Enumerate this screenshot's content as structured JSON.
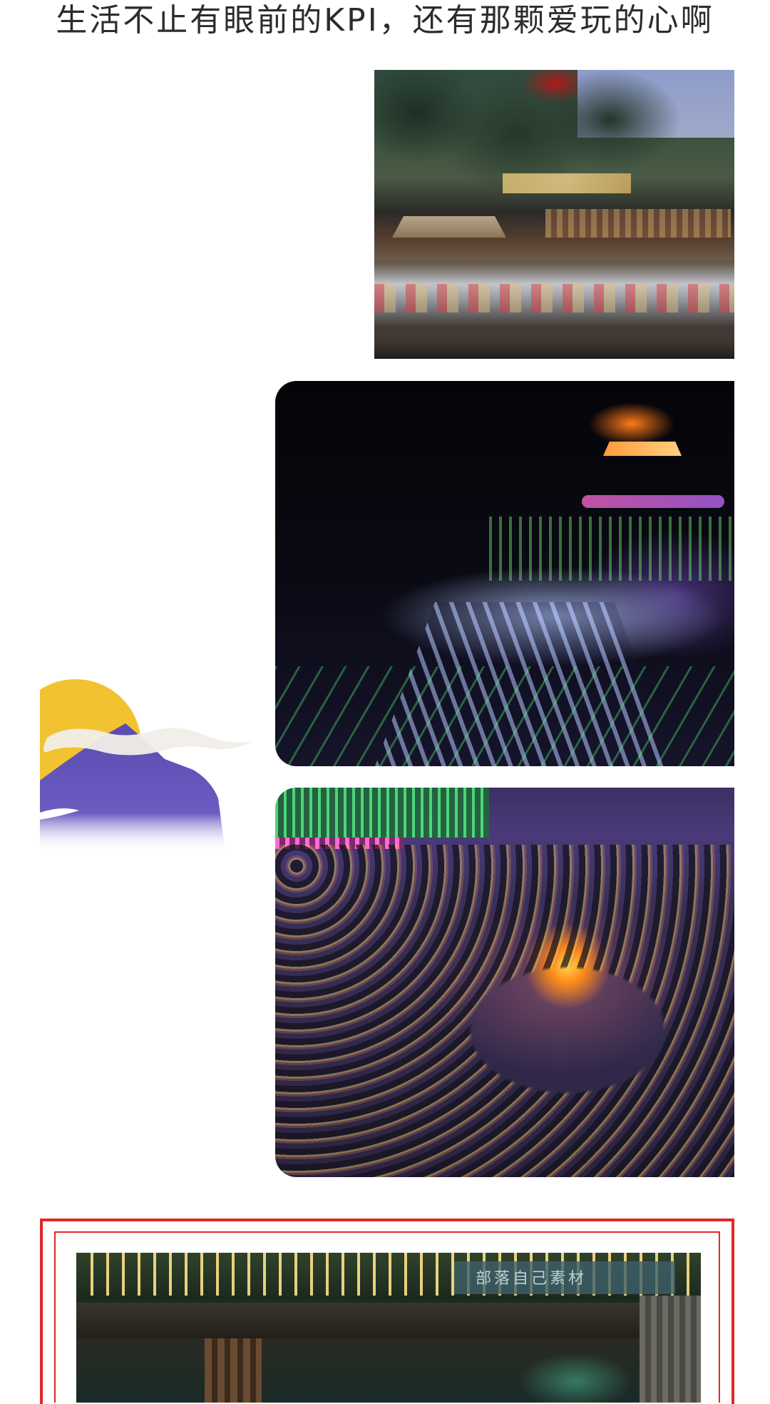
{
  "headline": "生活不止有眼前的KPI，还有那颗爱玩的心啊",
  "photos": [
    {
      "name": "misty-lake-garden-photo"
    },
    {
      "name": "night-laser-light-show-photo"
    },
    {
      "name": "bonfire-crowd-photo"
    },
    {
      "name": "string-lights-pavilion-photo"
    }
  ],
  "framed_photo": {
    "sign_text": "部落自己素材"
  },
  "colors": {
    "frame_red": "#e32626",
    "sun_yellow": "#f2c230",
    "mountain_purple": "#5a4bb0",
    "text_dark": "#2c2c2c"
  },
  "icons": [
    "sun-mountain-decoration"
  ]
}
